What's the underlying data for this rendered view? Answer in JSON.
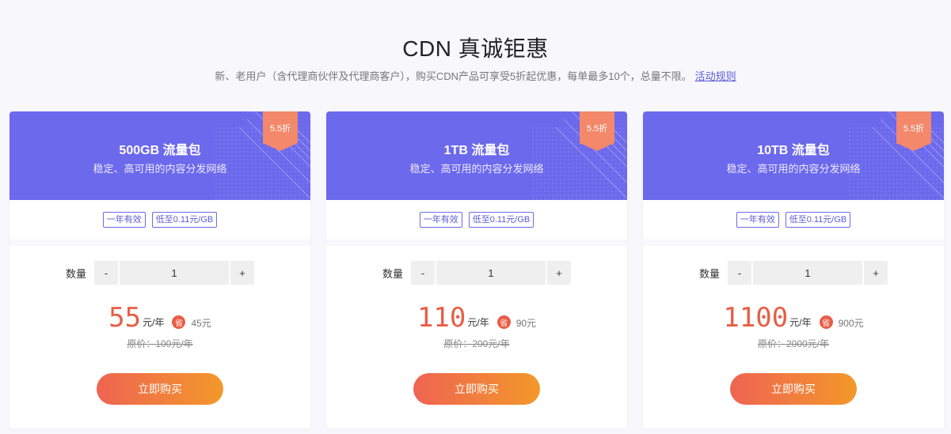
{
  "header": {
    "title": "CDN 真诚钜惠",
    "subtitle": "新、老用户（含代理商伙伴及代理商客户），购买CDN产品可享受5折起优惠，每单最多10个，总量不限。",
    "rules_link": "活动规则"
  },
  "colors": {
    "accent": "#6c69ec",
    "price": "#e95d46",
    "button_from": "#ef6452",
    "button_to": "#f3982a"
  },
  "cards": [
    {
      "name": "500GB 流量包",
      "desc": "稳定、高可用的内容分发网络",
      "discount": "5.5折",
      "tags": [
        "一年有效",
        "低至0.11元/GB"
      ],
      "qty_label": "数量",
      "minus": "-",
      "plus": "+",
      "quantity": "1",
      "price": "55",
      "unit": "元/年",
      "save_icon": "省",
      "save": "45元",
      "original": "原价：100元/年",
      "buy": "立即购买"
    },
    {
      "name": "1TB 流量包",
      "desc": "稳定、高可用的内容分发网络",
      "discount": "5.5折",
      "tags": [
        "一年有效",
        "低至0.11元/GB"
      ],
      "qty_label": "数量",
      "minus": "-",
      "plus": "+",
      "quantity": "1",
      "price": "110",
      "unit": "元/年",
      "save_icon": "省",
      "save": "90元",
      "original": "原价：200元/年",
      "buy": "立即购买"
    },
    {
      "name": "10TB 流量包",
      "desc": "稳定、高可用的内容分发网络",
      "discount": "5.5折",
      "tags": [
        "一年有效",
        "低至0.11元/GB"
      ],
      "qty_label": "数量",
      "minus": "-",
      "plus": "+",
      "quantity": "1",
      "price": "1100",
      "unit": "元/年",
      "save_icon": "省",
      "save": "900元",
      "original": "原价：2000元/年",
      "buy": "立即购买"
    }
  ]
}
